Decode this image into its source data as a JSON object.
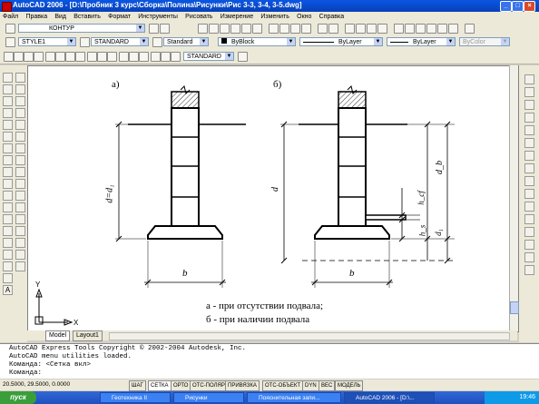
{
  "window": {
    "title": "AutoCAD 2006 - [D:\\Пробник 3 курс\\Сборка\\Полина\\Рисунки\\Рис 3-3, 3-4, 3-5.dwg]"
  },
  "menu": [
    "Файл",
    "Правка",
    "Вид",
    "Вставить",
    "Формат",
    "Инструменты",
    "Рисовать",
    "Измерение",
    "Изменить",
    "Окно",
    "Справка"
  ],
  "toolbar": {
    "layer": "КОНТУР",
    "text_style": "STYLE1",
    "dim_style": "STANDARD",
    "table_style": "Standard",
    "color": "ByBlock",
    "linetype": "ByLayer",
    "lineweight": "ByLayer",
    "plot_style": "ByColor",
    "dim_style2": "STANDARD"
  },
  "drawing": {
    "label_a": "а)",
    "label_b": "б)",
    "dim_d_d1": "d=d₁",
    "dim_b_left": "b",
    "dim_d": "d",
    "dim_db": "d_b",
    "dim_hcf": "h_cf",
    "dim_hs": "h_s",
    "dim_d1": "d₁",
    "dim_b_right": "b",
    "caption1": "а - при отсутствии подвала;",
    "caption2": "б - при наличии подвала",
    "ucs_x": "X",
    "ucs_y": "Y"
  },
  "tabs": [
    "Model",
    "Layout1"
  ],
  "command_lines": [
    "AutoCAD Express Tools Copyright © 2002-2004 Autodesk, Inc.",
    "AutoCAD menu utilities loaded.",
    "Команда:  <Сетка вкл>",
    "Команда:"
  ],
  "status": {
    "coords": "20.5000, 29.5000, 0.0000",
    "buttons": [
      "ШАГ",
      "СЕТКА",
      "ОРТО",
      "ОТС-ПОЛЯР",
      "ПРИВЯЗКА",
      "ОТС-ОБЪЕКТ",
      "DYN",
      "ВЕС",
      "МОДЕЛЬ"
    ]
  },
  "taskbar": {
    "start": "пуск",
    "tasks": [
      "Геотехника II",
      "Рисунки",
      "Пояснительная запи...",
      "AutoCAD 2006 - [D:\\..."
    ],
    "clock": "19:46"
  },
  "colors": {
    "titlebar": "#0a56e2",
    "canvas": "#ffffff",
    "taskbar": "#3168d5"
  }
}
